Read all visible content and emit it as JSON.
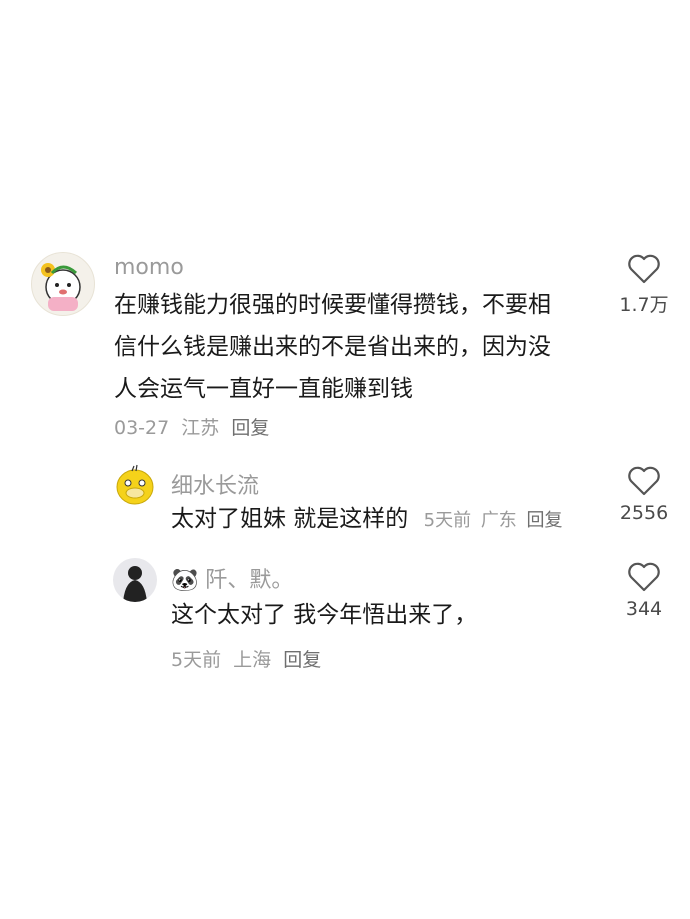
{
  "comments": [
    {
      "username": "momo",
      "text_lines": [
        "在赚钱能力很强的时候要懂得攒钱，不要相",
        "信什么钱是赚出来的不是省出来的，因为没",
        "人会运气一直好一直能赚到钱"
      ],
      "date": "03-27",
      "location": "江苏",
      "reply_label": "回复",
      "like_count": "1.7万",
      "avatar_icon": "cartoon-flower-face-avatar"
    },
    {
      "username": "细水长流",
      "text": "太对了姐妹 就是这样的",
      "date": "5天前",
      "location": "广东",
      "reply_label": "回复",
      "like_count": "2556",
      "avatar_icon": "yellow-duck-avatar"
    },
    {
      "username_emoji": "🐼",
      "username": "阡、默。",
      "text": "这个太对了 我今年悟出来了，",
      "date": "5天前",
      "location": "上海",
      "reply_label": "回复",
      "like_count": "344",
      "avatar_icon": "dark-figure-avatar"
    }
  ],
  "colors": {
    "secondary_text": "#9a9a9a",
    "body_text": "#1a1a1a"
  }
}
